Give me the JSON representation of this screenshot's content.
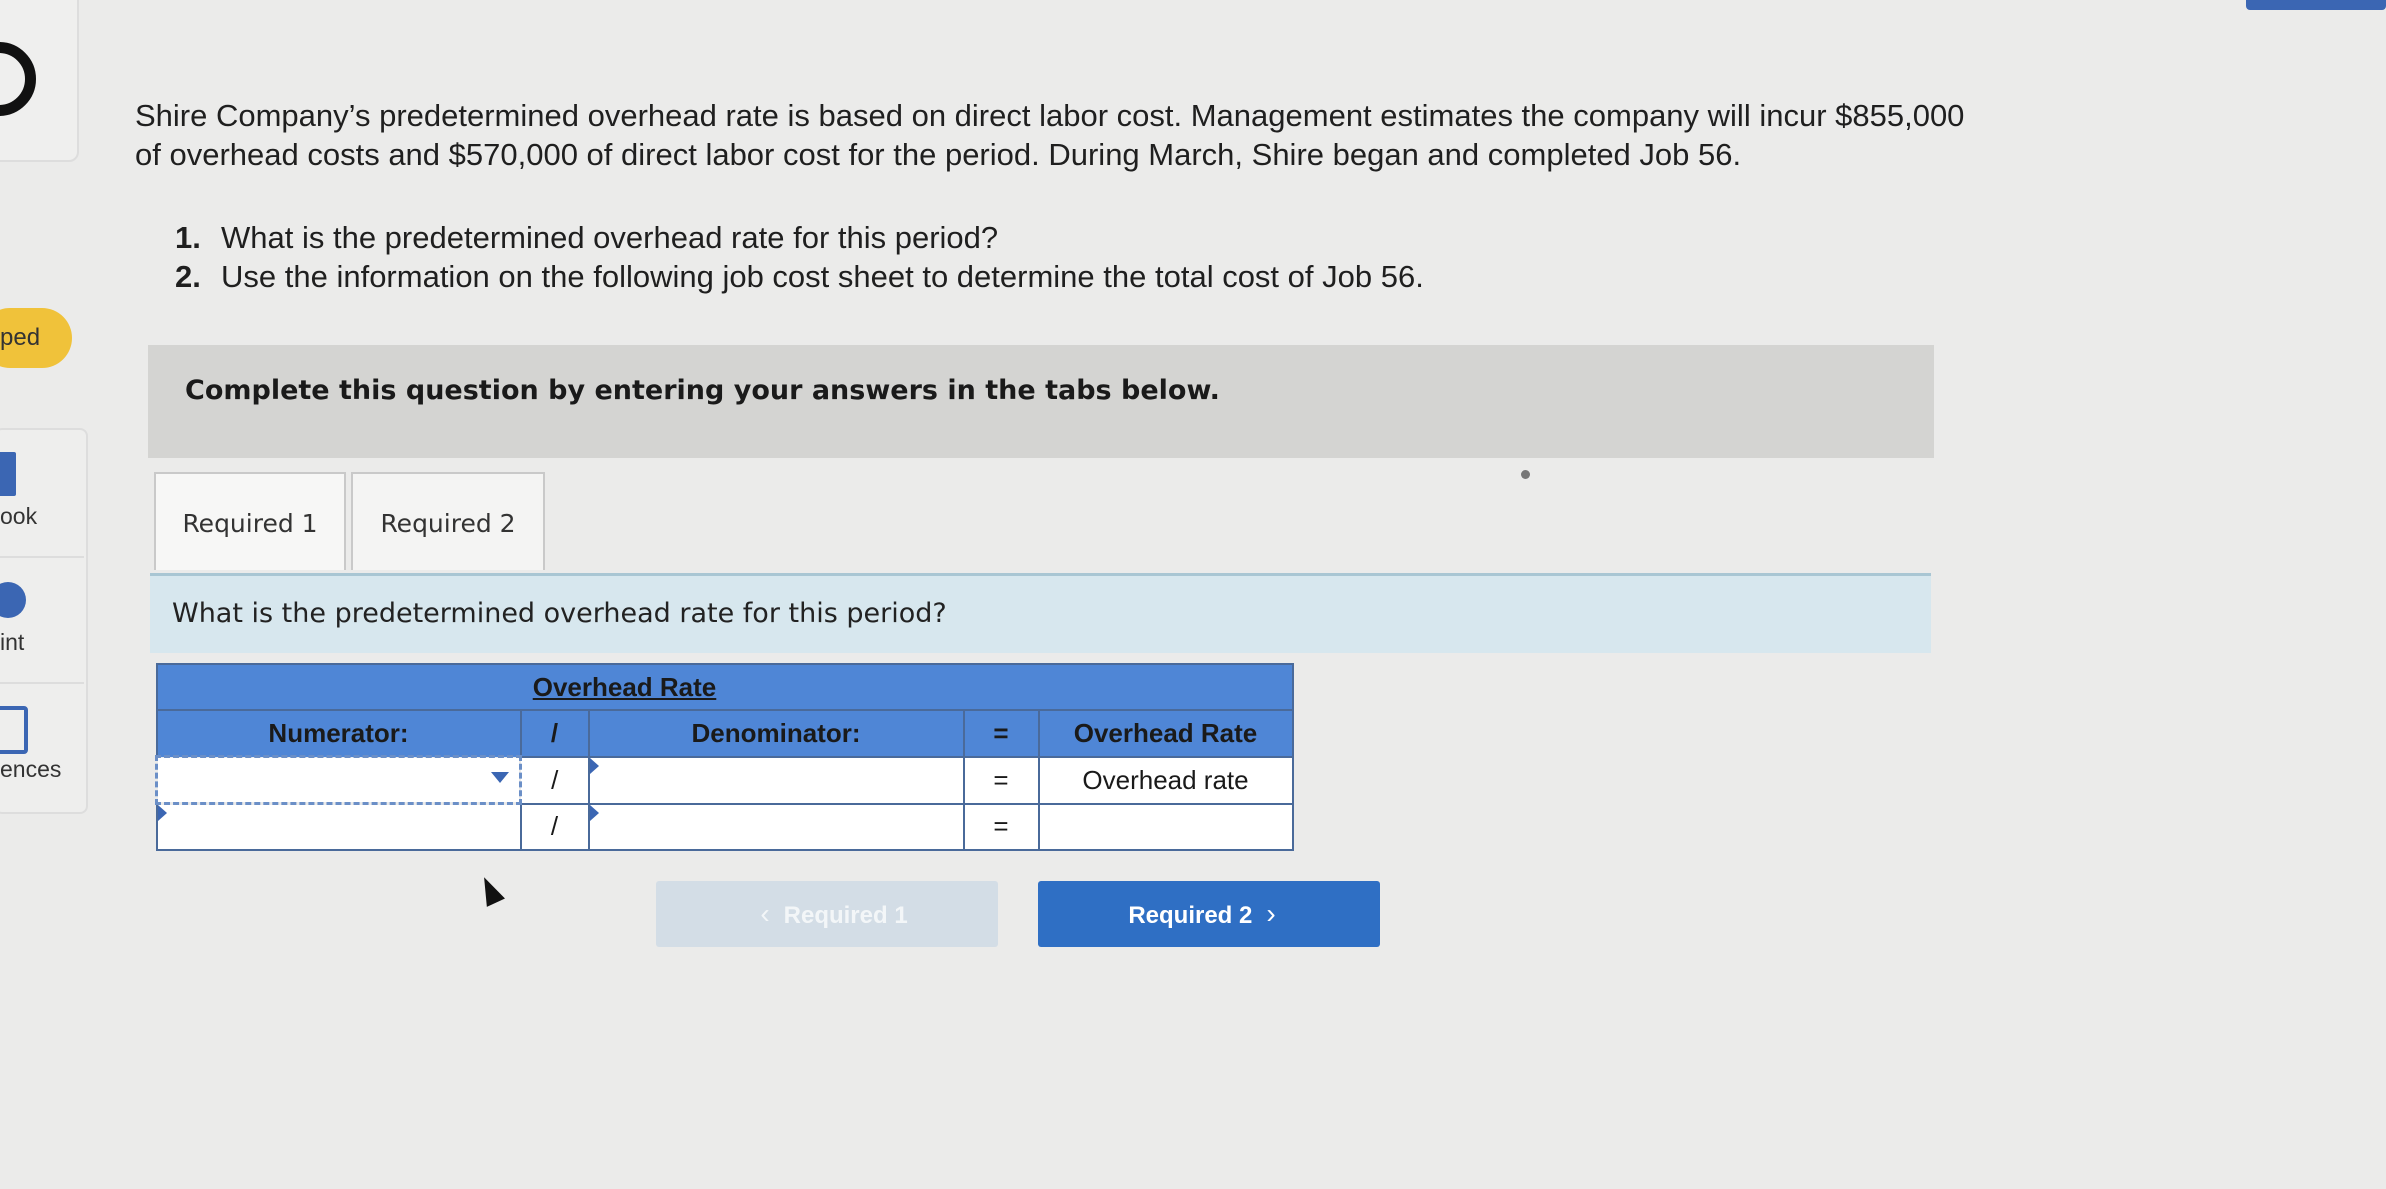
{
  "sidebar": {
    "items": [
      {
        "label": "ped"
      },
      {
        "label": "ook"
      },
      {
        "label": "int"
      },
      {
        "label": "ences"
      }
    ]
  },
  "problem": {
    "intro_line1": "Shire Company’s predetermined overhead rate is based on direct labor cost. Management estimates the company will incur $855,000",
    "intro_line2": "of overhead costs and $570,000 of direct labor cost for the period. During March, Shire began and completed Job 56.",
    "questions": [
      {
        "num": "1.",
        "text": "What is the predetermined overhead rate for this period?"
      },
      {
        "num": "2.",
        "text": "Use the information on the following job cost sheet to determine the total cost of Job 56."
      }
    ]
  },
  "banner": {
    "text": "Complete this question by entering your answers in the tabs below."
  },
  "tabs": [
    {
      "label": "Required 1",
      "active": true
    },
    {
      "label": "Required 2",
      "active": false
    }
  ],
  "question_bar": {
    "text": "What is the predetermined overhead rate for this period?"
  },
  "grid": {
    "title": "Overhead Rate",
    "headers": {
      "numerator": "Numerator:",
      "divide": "/",
      "denominator": "Denominator:",
      "equals": "=",
      "result": "Overhead Rate"
    },
    "rows": [
      {
        "numerator": "",
        "divide": "/",
        "denominator": "",
        "equals": "=",
        "result": "Overhead rate"
      },
      {
        "numerator": "",
        "divide": "/",
        "denominator": "",
        "equals": "=",
        "result": ""
      }
    ]
  },
  "nav": {
    "prev_label": "Required 1",
    "next_label": "Required 2"
  },
  "colors": {
    "accent_blue": "#2f6fc4",
    "header_blue": "#4f86d6",
    "banner_gray": "#d4d4d2",
    "question_bar": "#d7e7ee",
    "pill_yellow": "#f0c23a"
  }
}
